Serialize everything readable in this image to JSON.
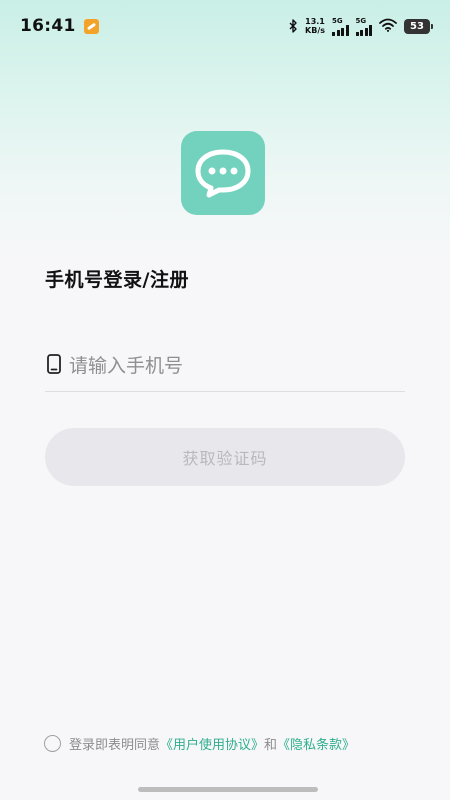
{
  "status_bar": {
    "time": "16:41",
    "net_speed_value": "13.1",
    "net_speed_unit": "KB/s",
    "signal1_label": "5G",
    "signal2_label": "5G",
    "battery": "53"
  },
  "login": {
    "title": "手机号登录/注册",
    "phone_placeholder": "请输入手机号",
    "get_code_label": "获取验证码"
  },
  "agreement": {
    "prefix": "登录即表明同意",
    "user_agreement": "《用户使用协议》",
    "connector": "和",
    "privacy_policy": "《隐私条款》"
  },
  "colors": {
    "accent": "#2fae8e",
    "logo_bg": "#73d2bd",
    "button_disabled_bg": "#e8e8ec",
    "button_disabled_text": "#b9b9bd"
  }
}
